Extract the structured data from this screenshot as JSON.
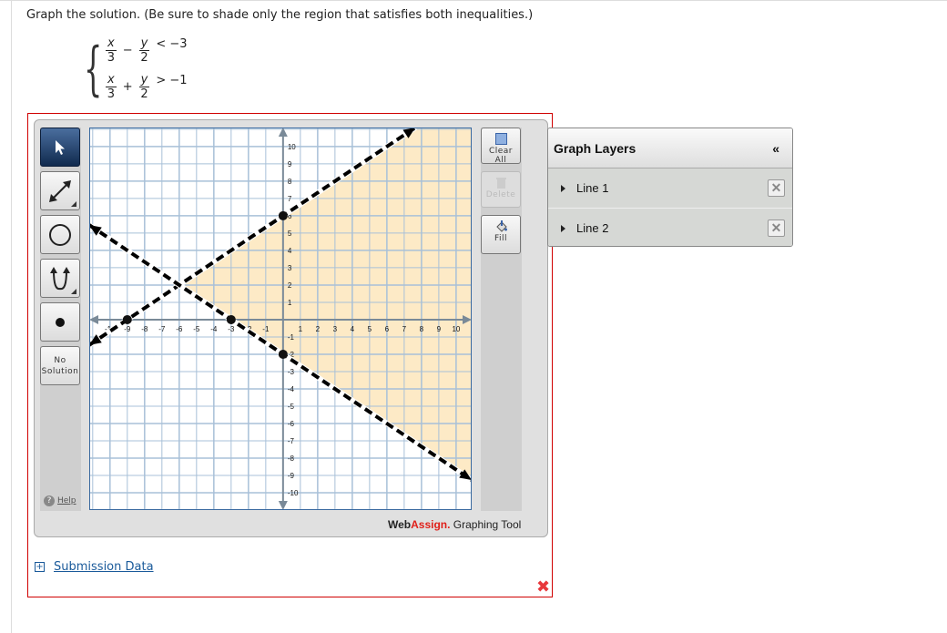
{
  "prompt": "Graph the solution. (Be sure to shade only the region that satisfies both inequalities.)",
  "system": [
    {
      "t1_num": "x",
      "t1_den": "3",
      "op": "−",
      "t2_num": "y",
      "t2_den": "2",
      "rel": "< −3"
    },
    {
      "t1_num": "x",
      "t1_den": "3",
      "op": "+",
      "t2_num": "y",
      "t2_den": "2",
      "rel": "> −1"
    }
  ],
  "tools": {
    "left": [
      {
        "name": "pointer-tool",
        "icon": "cursor-arrow-icon",
        "active": true
      },
      {
        "name": "line-tool",
        "icon": "double-arrow-line-icon"
      },
      {
        "name": "circle-tool",
        "icon": "circle-icon"
      },
      {
        "name": "parabola-tool",
        "icon": "parabola-icon"
      },
      {
        "name": "point-tool",
        "icon": "dot-icon"
      }
    ],
    "no_solution": [
      "No",
      "Solution"
    ],
    "help": "Help",
    "right": {
      "clear_all": "Clear All",
      "delete": "Delete",
      "fill": "Fill"
    }
  },
  "brand": {
    "web": "Web",
    "assign": "Assign.",
    "rest": " Graphing Tool"
  },
  "layers": {
    "title": "Graph Layers",
    "collapse": "«",
    "items": [
      {
        "label": "Line 1"
      },
      {
        "label": "Line 2"
      }
    ]
  },
  "submission": "Submission Data",
  "colors": {
    "shade": "#fde8c0",
    "grid": "#a8c0d8",
    "axis": "#7a8a98",
    "border_answer": "#d00000",
    "wrong": "#e8383c"
  },
  "chart_data": {
    "type": "line",
    "xlim": [
      -11.2,
      10.9
    ],
    "ylim": [
      -11,
      11.1
    ],
    "grid": true,
    "x_ticks": [
      -10,
      -9,
      -8,
      -7,
      -6,
      -5,
      -4,
      -3,
      -2,
      -1,
      1,
      2,
      3,
      4,
      5,
      6,
      7,
      8,
      9,
      10
    ],
    "y_ticks": [
      -10,
      -9,
      -8,
      -7,
      -6,
      -5,
      -4,
      -3,
      -2,
      -1,
      1,
      2,
      3,
      4,
      5,
      6,
      7,
      8,
      9,
      10
    ],
    "lines": [
      {
        "name": "Line 1",
        "points": [
          [
            -9,
            0
          ],
          [
            0,
            6
          ]
        ],
        "style": "dashed"
      },
      {
        "name": "Line 2",
        "points": [
          [
            -3,
            0
          ],
          [
            0,
            -2
          ]
        ],
        "style": "dashed"
      }
    ],
    "shaded_region": "below Line 1 and above Line 2"
  }
}
